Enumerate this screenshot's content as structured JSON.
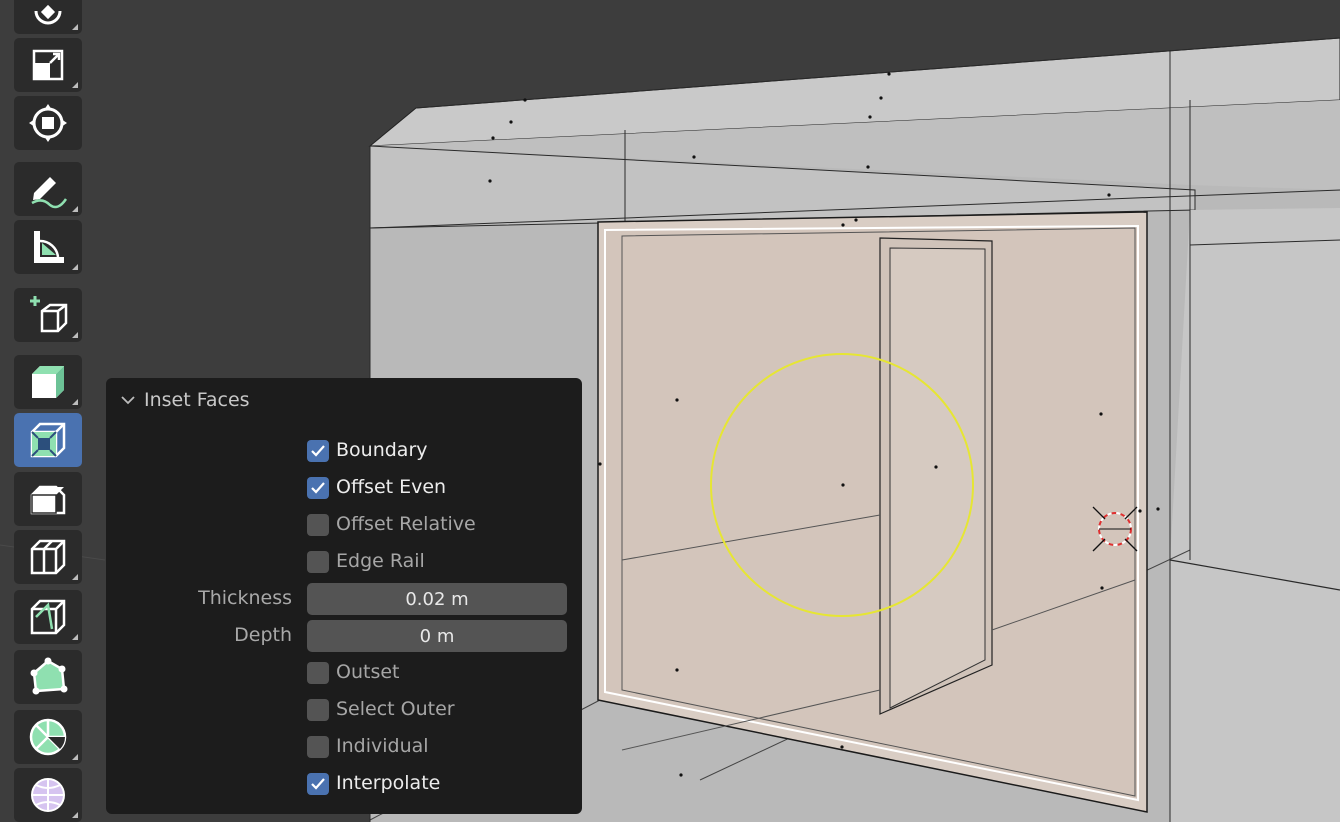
{
  "panel": {
    "title": "Inset Faces",
    "options": [
      {
        "label": "Boundary",
        "checked": true
      },
      {
        "label": "Offset Even",
        "checked": true
      },
      {
        "label": "Offset Relative",
        "checked": false
      },
      {
        "label": "Edge Rail",
        "checked": false
      }
    ],
    "fields": [
      {
        "label": "Thickness",
        "value": "0.02 m"
      },
      {
        "label": "Depth",
        "value": "0 m"
      }
    ],
    "options2": [
      {
        "label": "Outset",
        "checked": false
      },
      {
        "label": "Select Outer",
        "checked": false
      },
      {
        "label": "Individual",
        "checked": false
      },
      {
        "label": "Interpolate",
        "checked": true
      }
    ]
  },
  "toolbar": {
    "tools": [
      {
        "name": "rotate-tool",
        "icon": "rotate-icon",
        "active": false
      },
      {
        "name": "scale-tool",
        "icon": "scale-icon",
        "active": false
      },
      {
        "name": "transform-tool",
        "icon": "transform-icon",
        "active": false
      },
      {
        "name": "annotate-tool",
        "icon": "annotate-icon",
        "active": false
      },
      {
        "name": "measure-tool",
        "icon": "measure-icon",
        "active": false
      },
      {
        "name": "add-cube-tool",
        "icon": "add-cube-icon",
        "active": false
      },
      {
        "name": "extrude-region-tool",
        "icon": "extrude-icon",
        "active": false
      },
      {
        "name": "inset-faces-tool",
        "icon": "inset-icon",
        "active": true
      },
      {
        "name": "bevel-tool",
        "icon": "bevel-icon",
        "active": false
      },
      {
        "name": "loop-cut-tool",
        "icon": "loop-cut-icon",
        "active": false
      },
      {
        "name": "knife-tool",
        "icon": "knife-icon",
        "active": false
      },
      {
        "name": "poly-build-tool",
        "icon": "poly-build-icon",
        "active": false
      },
      {
        "name": "spin-tool",
        "icon": "spin-icon",
        "active": false
      },
      {
        "name": "smooth-tool",
        "icon": "smooth-icon",
        "active": false
      }
    ]
  },
  "colors": {
    "accent": "#4a72b0",
    "tool_green": "#8fe0b0",
    "selection_yellow": "#e6e633",
    "cursor_red": "#e03030"
  }
}
